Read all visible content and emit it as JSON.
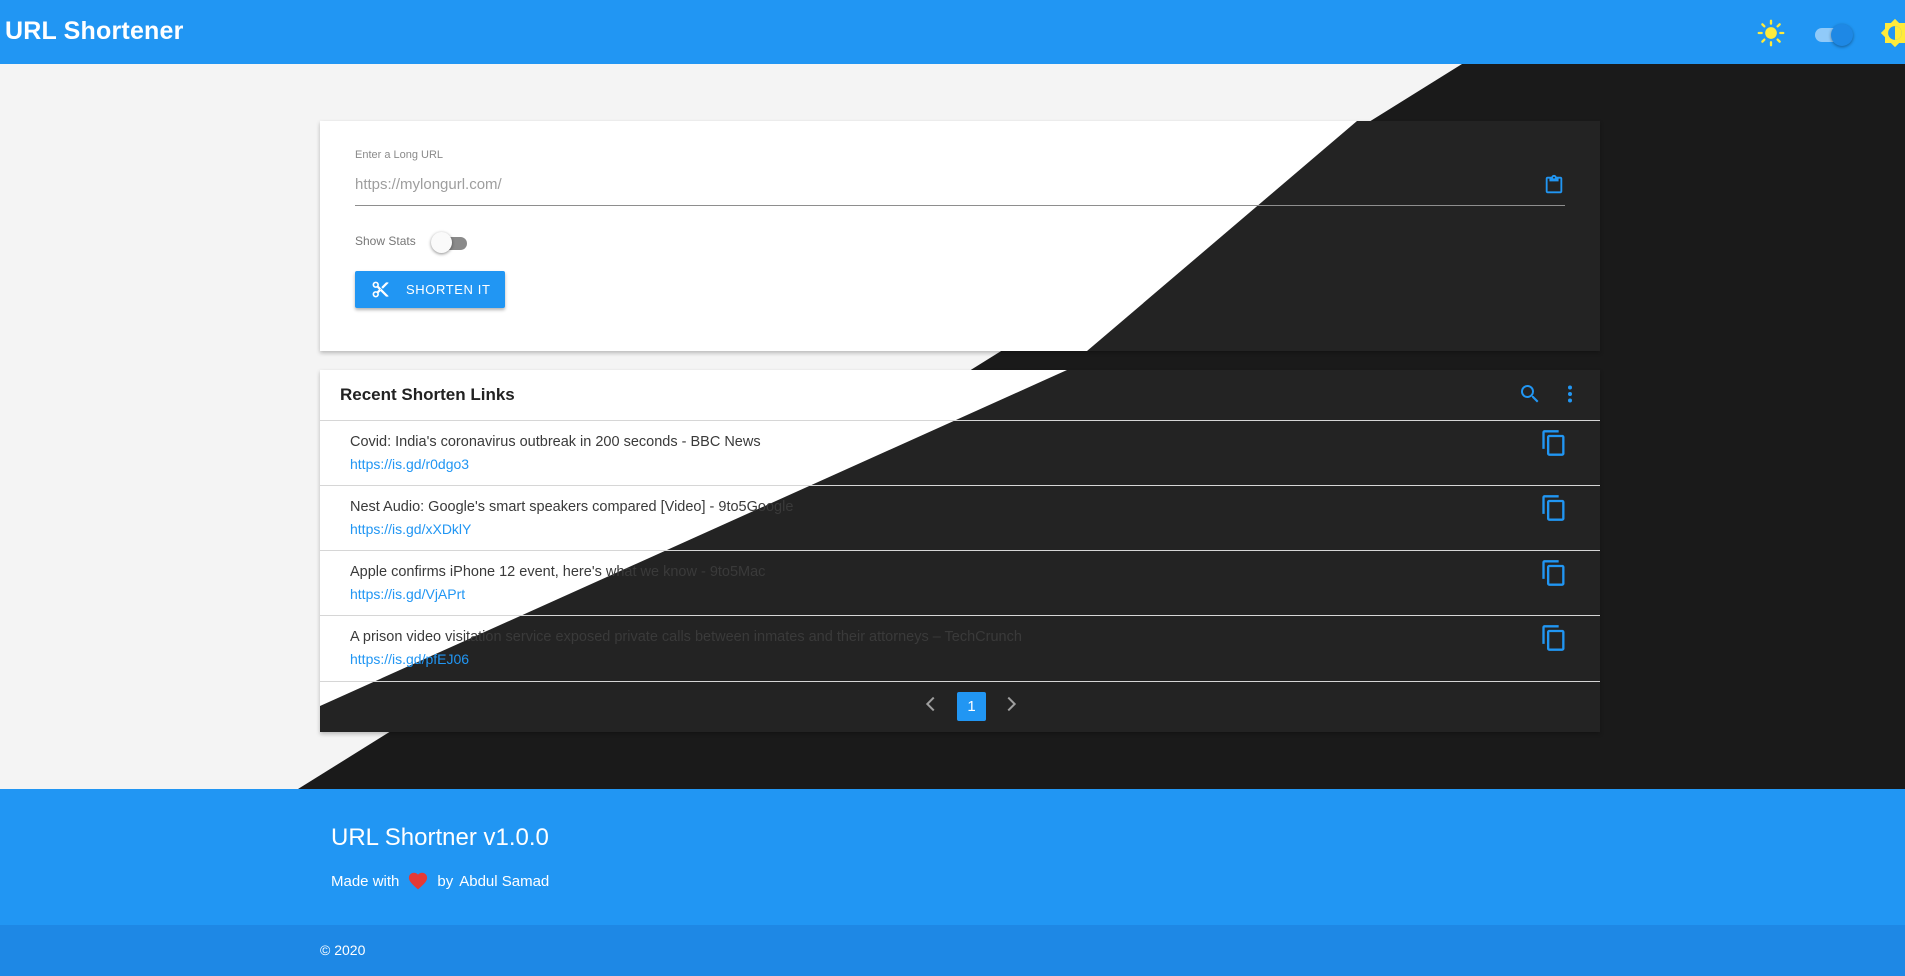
{
  "appbar": {
    "title": "URL Shortener",
    "icons": [
      "sun-icon",
      "theme-toggle",
      "brightness-icon"
    ]
  },
  "form": {
    "url_label": "Enter a Long URL",
    "url_placeholder": "https://mylongurl.com/",
    "url_value": "",
    "stats_label": "Show Stats",
    "show_stats": false,
    "shorten_label": "SHORTEN IT"
  },
  "recent": {
    "title": "Recent Shorten Links",
    "links": [
      {
        "title": "Covid: India's coronavirus outbreak in 200 seconds - BBC News",
        "url": "https://is.gd/r0dgo3"
      },
      {
        "title": "Nest Audio: Google's smart speakers compared [Video] - 9to5Google",
        "url": "https://is.gd/xXDklY"
      },
      {
        "title": "Apple confirms iPhone 12 event, here's what we know - 9to5Mac",
        "url": "https://is.gd/VjAPrt"
      },
      {
        "title": "A prison video visitation service exposed private calls between inmates and their attorneys – TechCrunch",
        "url": "https://is.gd/pfEJ06"
      }
    ],
    "current_page": "1"
  },
  "footer": {
    "title": "URL Shortner v1.0.0",
    "made_with": "Made with",
    "by": "by",
    "author": "Abdul Samad",
    "copyright": "© 2020"
  },
  "colors": {
    "primary": "#2196f3",
    "dark_bg": "#1a1a1a",
    "dark_card": "#232323",
    "light_bg": "#f4f4f4",
    "light_card": "#ffffff",
    "heart": "#e53935"
  }
}
